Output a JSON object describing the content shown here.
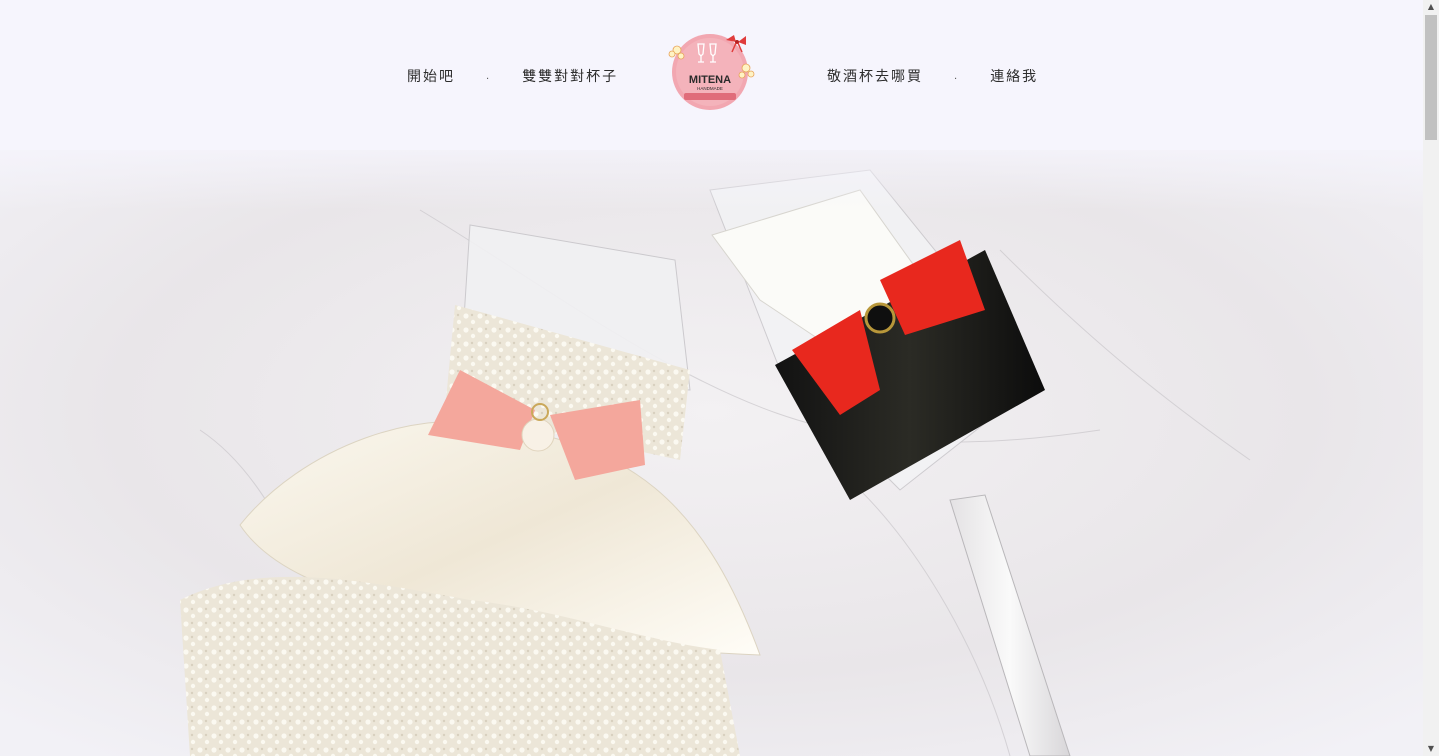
{
  "nav": {
    "left": [
      {
        "label": "開始吧"
      },
      {
        "label": "雙雙對對杯子"
      }
    ],
    "right": [
      {
        "label": "敬酒杯去哪買"
      },
      {
        "label": "連絡我"
      }
    ],
    "separator": "."
  },
  "logo": {
    "brand": "MITENA",
    "sub": "HANDMADE"
  },
  "colors": {
    "header_bg": "#f6f5fd",
    "text": "#2d2d2d",
    "logo_pink": "#f2a7b1",
    "bow_red": "#e8281e",
    "bow_pink": "#f4a79c"
  }
}
